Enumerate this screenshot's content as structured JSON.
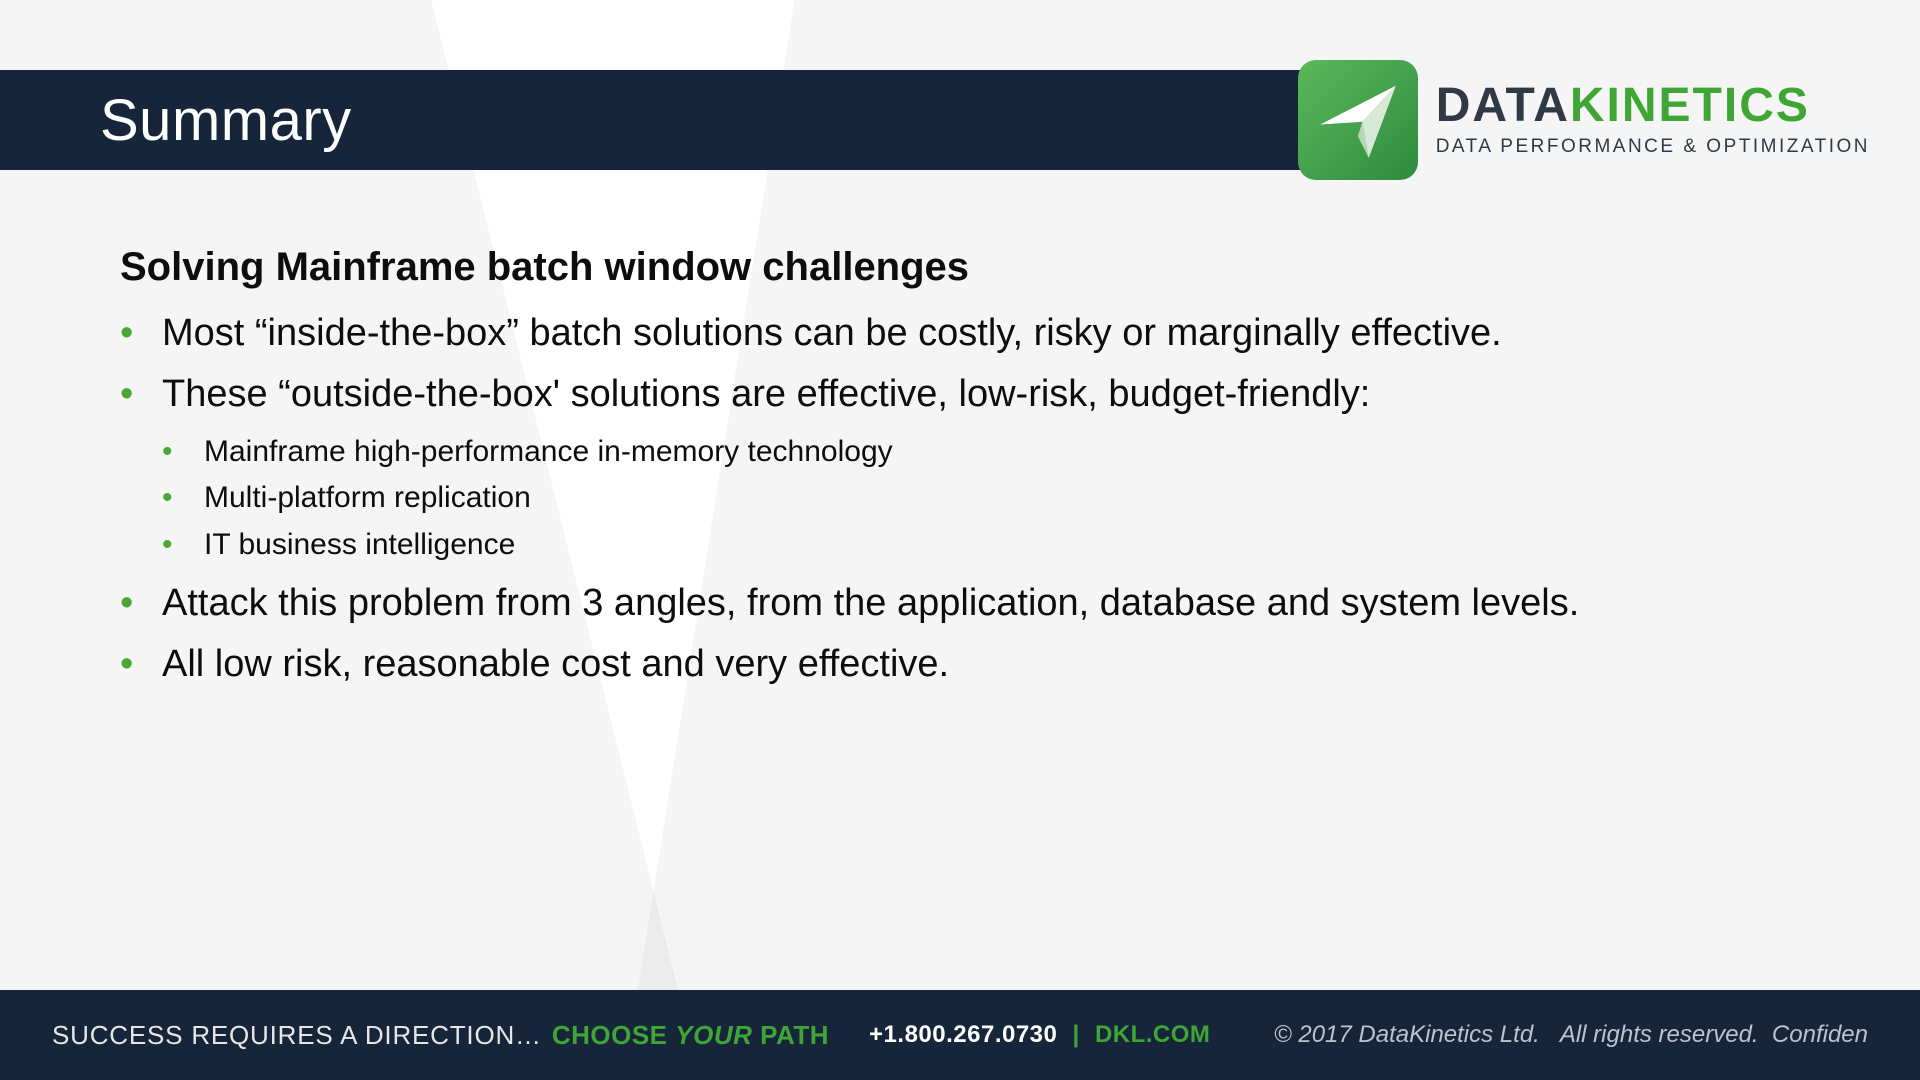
{
  "header": {
    "title": "Summary"
  },
  "logo": {
    "word1": "DATA",
    "word2": "KINETICS",
    "tagline": "DATA PERFORMANCE & OPTIMIZATION"
  },
  "content": {
    "subtitle": "Solving Mainframe batch window challenges",
    "bullets": [
      {
        "text": "Most “inside-the-box” batch solutions can be costly, risky or marginally effective."
      },
      {
        "text": "These “outside-the-box' solutions are effective, low-risk, budget-friendly:",
        "sub": [
          "Mainframe high-performance in-memory technology",
          "Multi-platform replication",
          "IT business intelligence"
        ]
      },
      {
        "text": "Attack this problem from 3 angles, from the application, database  and system levels."
      },
      {
        "text": "All low risk, reasonable cost and very effective."
      }
    ]
  },
  "footer": {
    "tag1": "SUCCESS REQUIRES A DIRECTION…",
    "tag2a": "CHOOSE ",
    "tag2b": "YOUR",
    "tag2c": " PATH",
    "phone": "+1.800.267.0730",
    "sep": "|",
    "site": "DKL.COM",
    "copyright": "© 2017 DataKinetics Ltd.   All rights reserved.  Confiden"
  }
}
